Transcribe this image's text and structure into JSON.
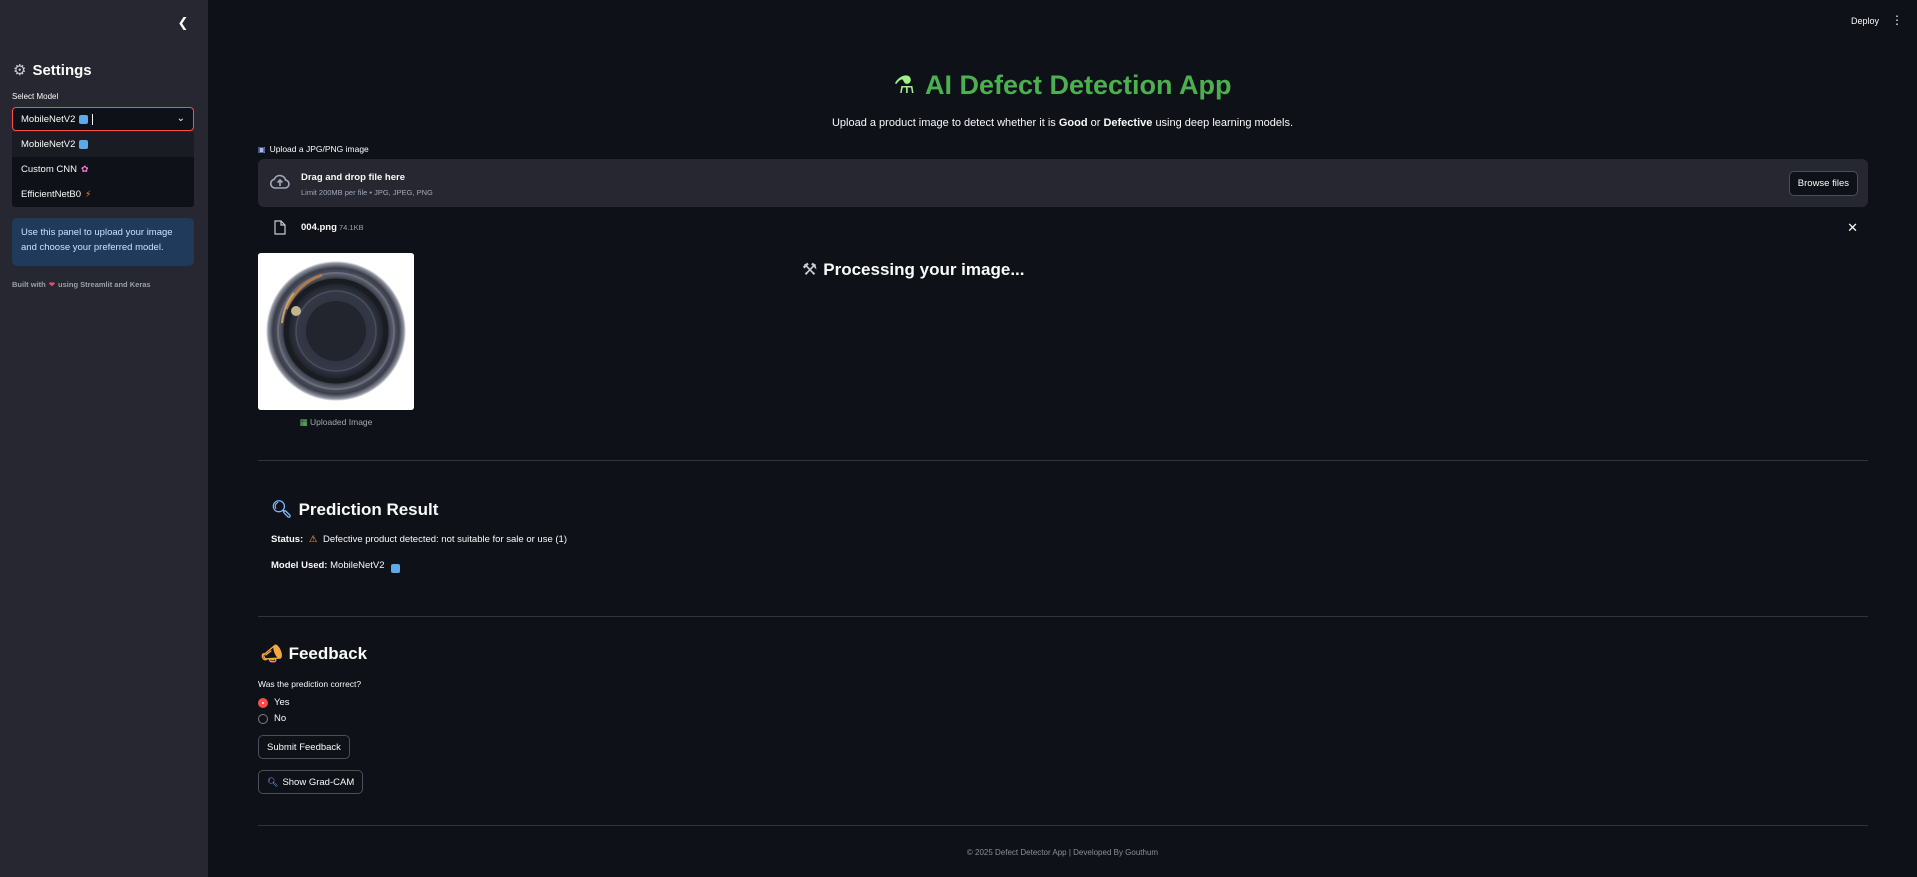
{
  "header": {
    "deploy_label": "Deploy",
    "menu_icon": "kebab-menu-icon"
  },
  "sidebar": {
    "collapse_icon": "chevron-left-icon",
    "title": "Settings",
    "title_icon": "gear-icon",
    "select_label": "Select Model",
    "select_value": "MobileNetV2",
    "options": [
      {
        "label": "MobileNetV2",
        "icon": "abc-tag-icon"
      },
      {
        "label": "Custom CNN",
        "icon": "brain-icon"
      },
      {
        "label": "EfficientNetB0",
        "icon": "lightning-icon"
      }
    ],
    "info_text": "Use this panel to upload your image and choose your preferred model.",
    "built_prefix": "Built with",
    "built_suffix": "using Streamlit and Keras"
  },
  "main": {
    "title": "AI Defect Detection App",
    "subtitle_prefix": "Upload a product image to detect whether it is",
    "subtitle_good": "Good",
    "subtitle_or": "or",
    "subtitle_defective": "Defective",
    "subtitle_suffix": "using deep learning models.",
    "uploader": {
      "label": "Upload a JPG/PNG image",
      "drop_text": "Drag and drop file here",
      "limit_text": "Limit 200MB per file • JPG, JPEG, PNG",
      "browse_label": "Browse files"
    },
    "file": {
      "name": "004.png",
      "size": "74.1KB"
    },
    "image_caption": "Uploaded Image",
    "processing_text": "Processing your image...",
    "prediction": {
      "title": "Prediction Result",
      "status_label": "Status:",
      "status_text": "Defective product detected: not suitable for sale or use (1)",
      "model_label": "Model Used:",
      "model_value": "MobileNetV2"
    },
    "feedback": {
      "title": "Feedback",
      "question": "Was the prediction correct?",
      "options": [
        "Yes",
        "No"
      ],
      "selected": "Yes",
      "submit_label": "Submit Feedback",
      "gradcam_label": "Show Grad-CAM"
    },
    "footer": "© 2025 Defect Detector App | Developed By Gouthum"
  },
  "colors": {
    "accent": "#ff4b4b",
    "title_green": "#4caf50",
    "info_bg": "#1f3a5a",
    "bg": "#0e1117",
    "sidebar_bg": "#262730"
  }
}
